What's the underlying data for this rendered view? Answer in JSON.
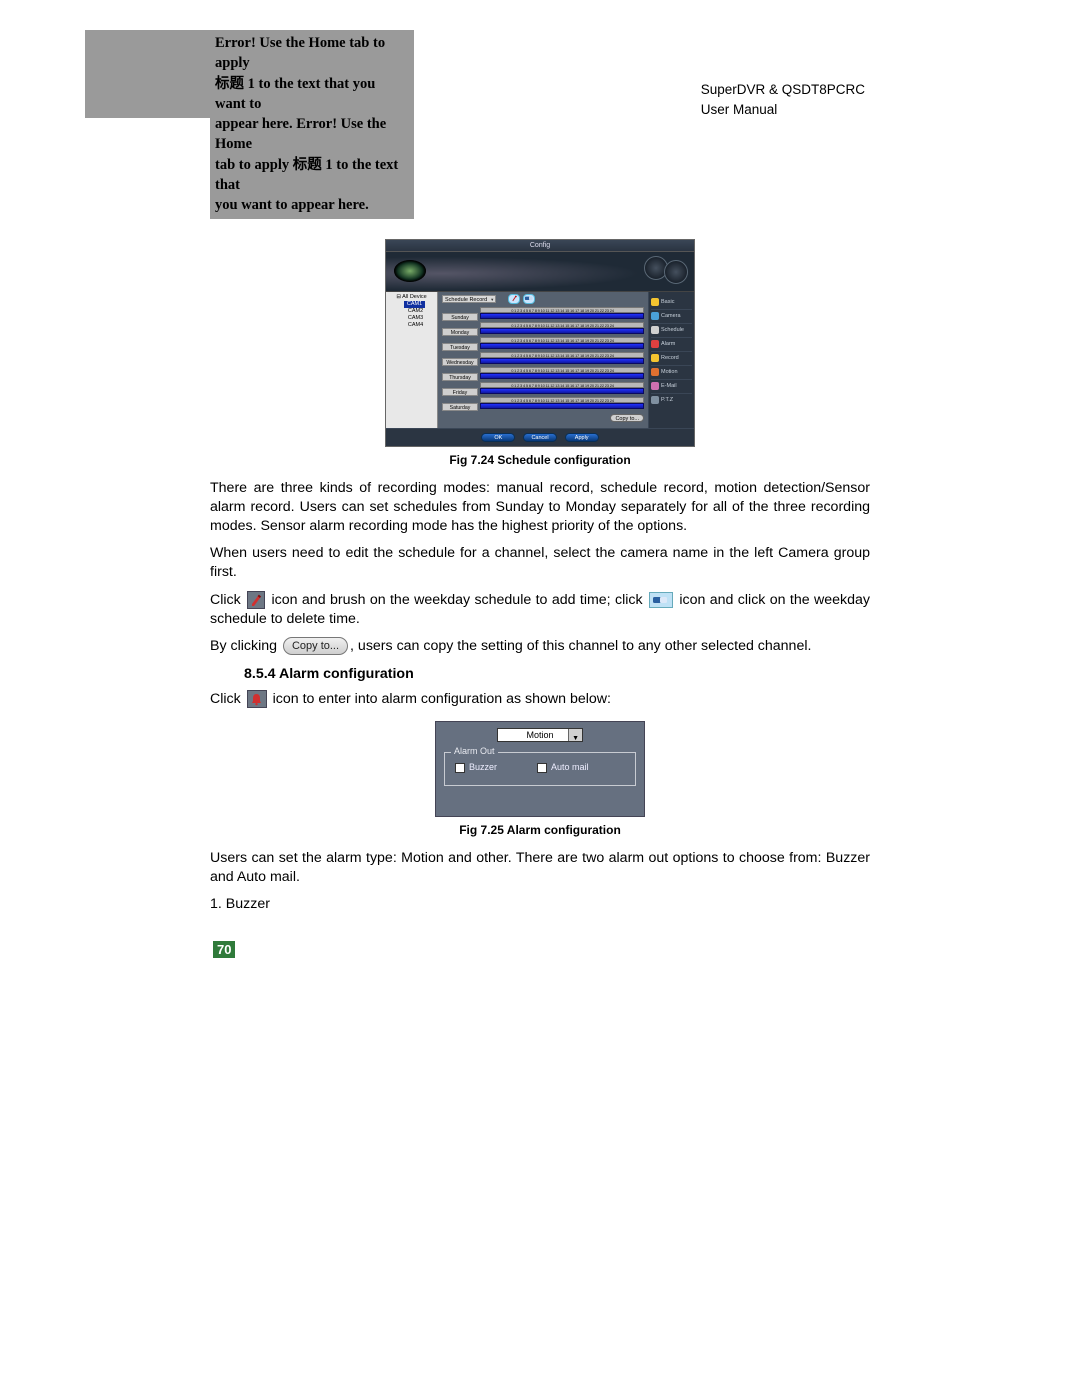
{
  "header": {
    "error_text_l1": "Error! Use the Home tab to apply",
    "error_text_l2a": "标题",
    "error_text_l2b": " 1 to the text that you want to",
    "error_text_l3": "appear here. Error! Use the Home",
    "error_text_l4a": "tab to apply ",
    "error_text_l4b": "标题",
    "error_text_l4c": " 1 to the text that",
    "error_text_l5": "you want to appear here.",
    "product": "SuperDVR & QSDT8PCRC",
    "manual": "User  Manual"
  },
  "fig1": {
    "window_title": "Config",
    "tree_root": "⊟ All Device",
    "cams": [
      "CAM1",
      "CAM2",
      "CAM3",
      "CAM4"
    ],
    "dropdown": "Schedule Record",
    "hours_scale": "0  1  2  3  4  5  6  7  8  9  10 11 12 13 14 15 16 17 18 19 20 21 22 23 24",
    "days": [
      "Sunday",
      "Monday",
      "Tuesday",
      "Wednesday",
      "Thursday",
      "Friday",
      "Saturday"
    ],
    "copy_btn": "Copy to...",
    "side_items": [
      {
        "label": "Basic",
        "color": "#f4c430"
      },
      {
        "label": "Camera",
        "color": "#4aa0d8"
      },
      {
        "label": "Schedule",
        "color": "#d0d0d0"
      },
      {
        "label": "Alarm",
        "color": "#e04040"
      },
      {
        "label": "Record",
        "color": "#f4c430"
      },
      {
        "label": "Motion",
        "color": "#e07030"
      },
      {
        "label": "E-Mail",
        "color": "#d070b0"
      },
      {
        "label": "P.T.Z",
        "color": "#8090a0"
      }
    ],
    "foot_ok": "OK",
    "foot_cancel": "Cancel",
    "foot_apply": "Apply",
    "caption": "Fig 7.24 Schedule configuration"
  },
  "body": {
    "p1": "There are three kinds of recording modes: manual record, schedule record, motion detection/Sensor alarm record. Users can set schedules from Sunday to Monday separately for all of the three recording modes. Sensor alarm recording mode has the highest priority of the options.",
    "p2": "When users need to edit the schedule for a channel, select the camera name in the left Camera group first.",
    "p3a": "Click ",
    "p3b": " icon and brush on the weekday schedule to add time; click ",
    "p3c": " icon and click on the weekday schedule to delete time.",
    "p4a": "By clicking ",
    "copy_label": "Copy to...",
    "p4b": ", users can copy the setting of this channel to any other selected channel.",
    "sec_head": "8.5.4  Alarm configuration",
    "p5a": "Click ",
    "p5b": " icon to enter into alarm configuration as shown below:"
  },
  "fig2": {
    "dropdown": "Motion",
    "group": "Alarm Out",
    "opt1": "Buzzer",
    "opt2": "Auto mail",
    "caption": "Fig 7.25 Alarm configuration"
  },
  "tail": {
    "p6": "Users can set the alarm type: Motion and other. There are two alarm out options to choose from: Buzzer and Auto mail.",
    "p7": "1. Buzzer"
  },
  "page_number": "70"
}
